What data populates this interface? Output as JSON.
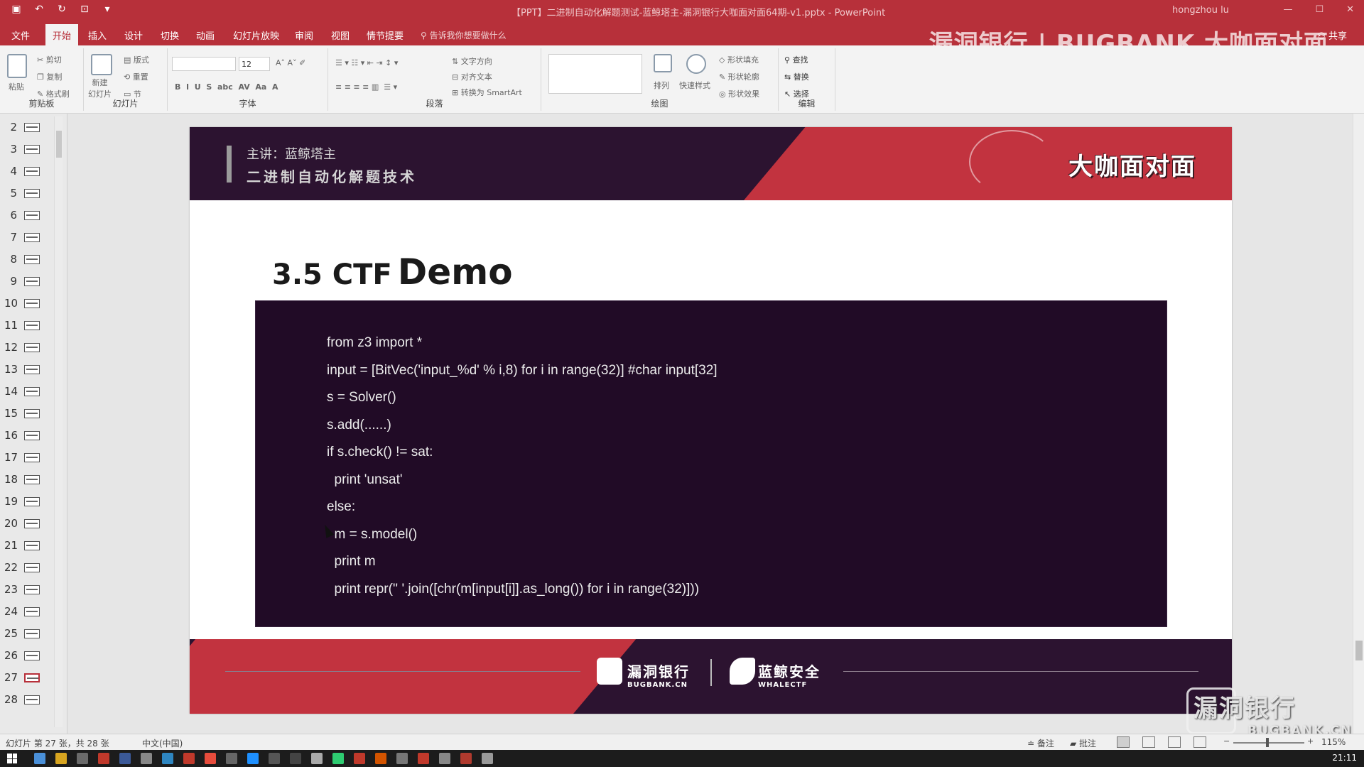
{
  "titlebar": {
    "title": "【PPT】二进制自动化解题测试-蓝鲸塔主-漏洞银行大咖面对面64期-v1.pptx - PowerPoint",
    "user": "hongzhou lu"
  },
  "tabs": [
    "文件",
    "开始",
    "插入",
    "设计",
    "切换",
    "动画",
    "幻灯片放映",
    "审阅",
    "视图",
    "情节提要"
  ],
  "active_tab": "开始",
  "tell_me": "告诉我你想要做什么",
  "share": "共享",
  "watermark_top": "漏洞银行 | BUGBANK 大咖面对面",
  "ribbon": {
    "clipboard": {
      "label": "剪贴板",
      "paste": "粘贴",
      "cut": "剪切",
      "copy": "复制",
      "format_painter": "格式刷"
    },
    "slides": {
      "label": "幻灯片",
      "new_slide": "新建\n幻灯片",
      "layout": "版式",
      "reset": "重置",
      "section": "节"
    },
    "font": {
      "label": "字体",
      "size": "12"
    },
    "paragraph": {
      "label": "段落",
      "text_direction": "文字方向",
      "align_text": "对齐文本",
      "smartart": "转换为 SmartArt"
    },
    "drawing": {
      "label": "绘图",
      "arrange": "排列",
      "quick_styles": "快速样式",
      "shape_fill": "形状填充",
      "shape_outline": "形状轮廓",
      "shape_effects": "形状效果"
    },
    "editing": {
      "label": "编辑",
      "find": "查找",
      "replace": "替换",
      "select": "选择"
    }
  },
  "thumbnails": [
    2,
    3,
    4,
    5,
    6,
    7,
    8,
    9,
    10,
    11,
    12,
    13,
    14,
    15,
    16,
    17,
    18,
    19,
    20,
    21,
    22,
    23,
    24,
    25,
    26,
    27,
    28
  ],
  "slide": {
    "speaker": "主讲：蓝鲸塔主",
    "banner_title": "二进制自动化解题技术",
    "banner_logo": "大咖面对面",
    "heading_prefix": "3.5 CTF",
    "heading_main": "Demo",
    "code": [
      "from z3 import *",
      "input = [BitVec('input_%d' % i,8) for i in range(32)] #char input[32]",
      "s = Solver()",
      "s.add(......)",
      "if s.check() != sat:",
      "  print 'unsat'",
      "else:",
      "  m = s.model()",
      "  print m",
      "  print repr('' '.join([chr(m[input[i]].as_long()) for i in range(32)]))"
    ],
    "footer_logo1": "漏洞银行",
    "footer_logo1_sub": "BUGBANK.CN",
    "footer_logo2": "蓝鲸安全",
    "footer_logo2_sub": "WHALECTF"
  },
  "watermark_bottom": {
    "line1": "漏洞银行",
    "line2": "BUGBANK.CN"
  },
  "statusbar": {
    "slide_info": "幻灯片 第 27 张，共 28 张",
    "language": "中文(中国)",
    "notes": "备注",
    "comments": "批注",
    "zoom": "115%"
  },
  "clock": "21:11",
  "colors": {
    "ribbon": "#b7303a",
    "banner": "#2c1330",
    "code_bg": "#210b26",
    "accent_red": "#c2333f"
  }
}
